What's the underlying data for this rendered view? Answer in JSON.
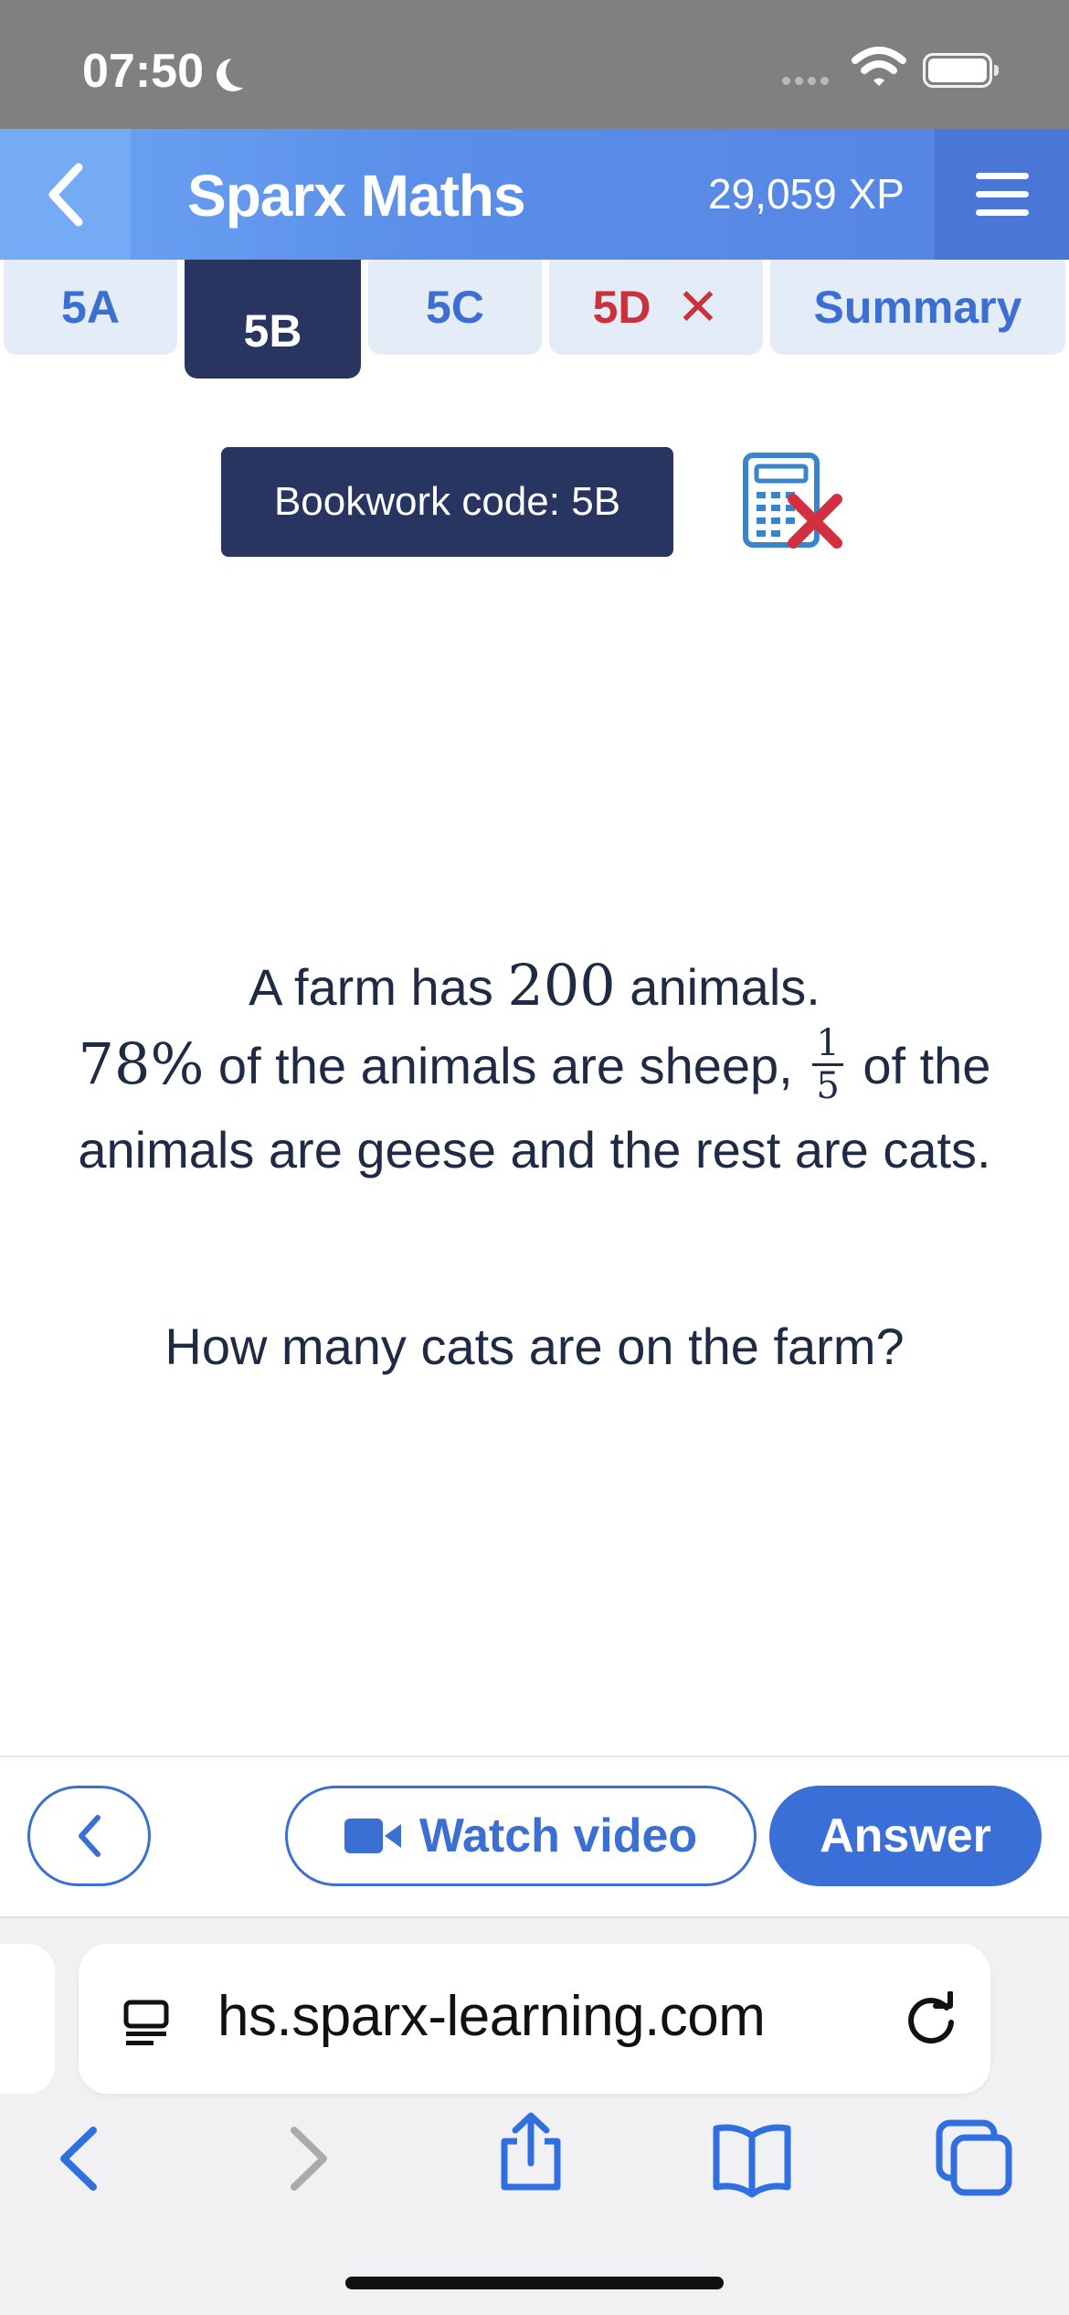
{
  "status_bar": {
    "time": "07:50"
  },
  "header": {
    "title": "Sparx Maths",
    "xp": "29,059 XP"
  },
  "tabs": [
    {
      "label": "5A",
      "state": "default"
    },
    {
      "label": "5B",
      "state": "active"
    },
    {
      "label": "5C",
      "state": "default"
    },
    {
      "label": "5D",
      "state": "incorrect"
    },
    {
      "label": "Summary",
      "state": "default"
    }
  ],
  "bookwork": {
    "label": "Bookwork code: 5B"
  },
  "question": {
    "line1_pre": "A farm has ",
    "line1_num": "200",
    "line1_post": " animals.",
    "pct": "78%",
    "line2_mid": " of the animals are sheep, ",
    "frac_num": "1",
    "frac_den": "5",
    "line2_post": " of the animals are geese and the rest are cats.",
    "prompt": "How many cats are on the farm?"
  },
  "actions": {
    "watch_video": "Watch video",
    "answer": "Answer"
  },
  "browser": {
    "url": "hs.sparx-learning.com"
  },
  "colors": {
    "brand_blue": "#3a6fd8",
    "navy": "#283561",
    "error_red": "#c8323c"
  }
}
